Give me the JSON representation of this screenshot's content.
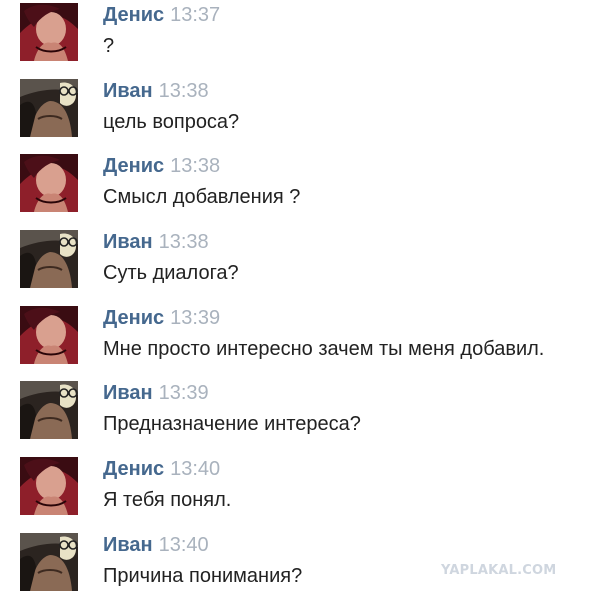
{
  "messages": [
    {
      "sender": "Денис",
      "time": "13:37",
      "text": "?",
      "avatar": "denis-avatar"
    },
    {
      "sender": "Иван",
      "time": "13:38",
      "text": "цель вопроса?",
      "avatar": "ivan-avatar"
    },
    {
      "sender": "Денис",
      "time": "13:38",
      "text": "Смысл добавления ?",
      "avatar": "denis-avatar"
    },
    {
      "sender": "Иван",
      "time": "13:38",
      "text": "Суть диалога?",
      "avatar": "ivan-avatar"
    },
    {
      "sender": "Денис",
      "time": "13:39",
      "text": "Мне просто интересно зачем ты меня добавил.",
      "avatar": "denis-avatar"
    },
    {
      "sender": "Иван",
      "time": "13:39",
      "text": "Предназначение интереса?",
      "avatar": "ivan-avatar"
    },
    {
      "sender": "Денис",
      "time": "13:40",
      "text": "Я тебя понял.",
      "avatar": "denis-avatar"
    },
    {
      "sender": "Иван",
      "time": "13:40",
      "text": "Причина понимания?",
      "avatar": "ivan-avatar"
    }
  ],
  "watermark": "YAPLAKAL.COM",
  "colors": {
    "sender_name": "#45688e",
    "timestamp": "#a9b2bd",
    "message_text": "#222222",
    "watermark": "#cfd6df"
  }
}
